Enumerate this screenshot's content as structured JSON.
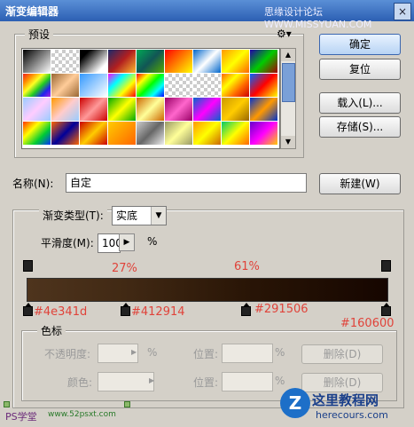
{
  "window": {
    "title": "渐变编辑器",
    "watermark_top": "思缘设计论坛  WWW.MISSYUAN.COM",
    "close_label": "×"
  },
  "presets": {
    "legend": "预设",
    "gear_icon": "gear-icon",
    "swatches": [
      "linear-gradient(135deg,#000,#fff)",
      "repeating-conic-gradient(#ccc 0 25%,#fff 0 50%) 0 0/8px 8px",
      "linear-gradient(135deg,#000 20%,#fff 80%)",
      "linear-gradient(135deg,#1a2a6c,#b21f1f,#fdbb2d)",
      "linear-gradient(135deg,#0a5,#155,#5a0)",
      "linear-gradient(135deg,#f00,#ff0)",
      "linear-gradient(135deg,#06c,#fff,#06c)",
      "linear-gradient(135deg,#f90,#ff0,#f60)",
      "linear-gradient(135deg,#20a,#0c0,#a00)",
      "linear-gradient(135deg,#e22,#f80,#ff2,#2c2,#22e,#a2d)",
      "linear-gradient(135deg,#963,#fc9,#963)",
      "linear-gradient(135deg,#39f,#fff)",
      "linear-gradient(135deg,#f0f,#0ff,#ff0,#f00)",
      "linear-gradient(135deg,#f00,#ff0,#0f0,#0ff,#00f)",
      "repeating-conic-gradient(#ccc 0 25%,#fff 0 50%) 0 0/8px 8px",
      "repeating-conic-gradient(#ccc 0 25%,#fff 0 50%) 0 0/8px 8px",
      "linear-gradient(135deg,#f60,#ff0,#f60,#c00)",
      "linear-gradient(135deg,#06f,#f00,#ff0)",
      "linear-gradient(135deg,#9cf,#fcf,#9cf)",
      "linear-gradient(135deg,#f90,#fcc,#9cf)",
      "linear-gradient(135deg,#c00,#f99,#c00)",
      "linear-gradient(135deg,#0a0,#ff0,#0a0)",
      "linear-gradient(135deg,#c60,#ff9,#c60)",
      "linear-gradient(135deg,#906,#f6c,#906)",
      "linear-gradient(135deg,#06c,#f0f,#06c)",
      "linear-gradient(135deg,#c90,#fc0,#960)",
      "linear-gradient(135deg,#03c,#f90,#03c)",
      "linear-gradient(135deg,#f30,#ff0,#0c3,#03f)",
      "linear-gradient(135deg,#f60,#009,#f60)",
      "linear-gradient(135deg,#c00,#fc0,#c00)",
      "linear-gradient(135deg,#fc0,#f60)",
      "linear-gradient(135deg,#ccc,#666,#eee)",
      "linear-gradient(135deg,#996,#ff9,#996)",
      "linear-gradient(135deg,#f90,#ff0,#c60)",
      "linear-gradient(135deg,#0c6,#ff0,#f60)",
      "linear-gradient(135deg,#60c,#f0f,#fc0)"
    ]
  },
  "buttons": {
    "ok": "确定",
    "reset": "复位",
    "load": "载入(L)...",
    "save": "存储(S)...",
    "new": "新建(W)"
  },
  "name": {
    "label": "名称(N):",
    "value": "自定"
  },
  "gradient": {
    "type_label": "渐变类型(T):",
    "type_value": "实底",
    "smooth_label": "平滑度(M):",
    "smooth_value": "100",
    "smooth_unit": "%",
    "percent_1": "27%",
    "percent_2": "61%",
    "stop_1": "#4e341d",
    "stop_2": "#412914",
    "stop_3": "#291506",
    "stop_4": "#160600"
  },
  "stops": {
    "legend": "色标",
    "opacity_label": "不透明度:",
    "opacity_unit": "%",
    "color_label": "颜色:",
    "location_label": "位置:",
    "location_unit": "%",
    "delete_label": "删除(D)"
  },
  "footer": {
    "ps_text": "PS学堂",
    "site_text": "www.52psxt.com",
    "logo_mark": "Z",
    "logo_title": "这里教程网",
    "logo_url": "herecours.com"
  }
}
